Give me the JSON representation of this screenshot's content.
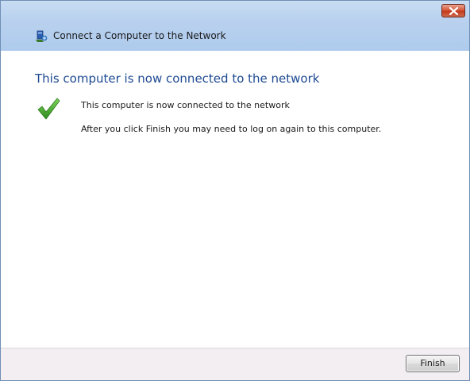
{
  "window": {
    "title": "Connect a Computer to the Network",
    "close_icon": "close-icon",
    "wizard_icon": "network-computer-icon"
  },
  "content": {
    "heading": "This computer is now connected to the network",
    "status_icon": "checkmark-icon",
    "status_text": "This computer is now connected to the network",
    "info_text": "After you click Finish you may need to log on again to this computer."
  },
  "footer": {
    "finish_label": "Finish"
  },
  "colors": {
    "heading": "#1e4a92",
    "titlebar": "#b9d1ee",
    "check": "#3fa72a",
    "footer": "#f2eef2"
  }
}
